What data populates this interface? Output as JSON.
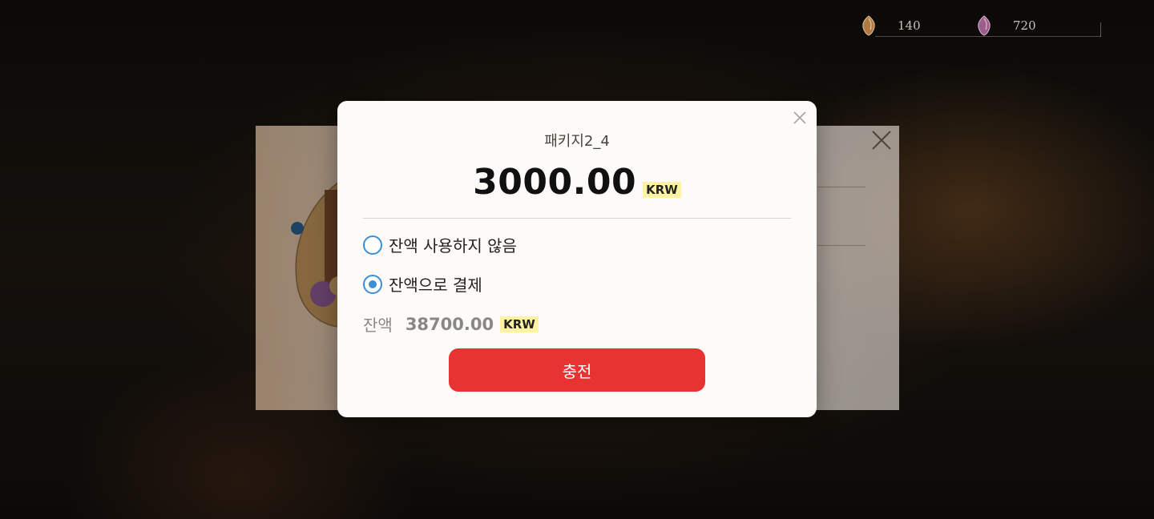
{
  "currencies": [
    {
      "icon": "amber-gem-icon",
      "value": "140",
      "color": "#b07a45"
    },
    {
      "icon": "purple-gem-icon",
      "value": "720",
      "color": "#9b5d8a"
    }
  ],
  "modal": {
    "title": "패키지2_4",
    "price": "3000.00",
    "currency": "KRW",
    "options": [
      {
        "label": "잔액 사용하지 않음",
        "selected": false
      },
      {
        "label": "잔액으로 결제",
        "selected": true
      }
    ],
    "balance_label": "잔액",
    "balance_amount": "38700.00",
    "balance_currency": "KRW",
    "charge_button": "충전"
  },
  "colors": {
    "accent_blue": "#3a8fd6",
    "button_red": "#e73332",
    "badge_yellow": "#fff3a3"
  }
}
